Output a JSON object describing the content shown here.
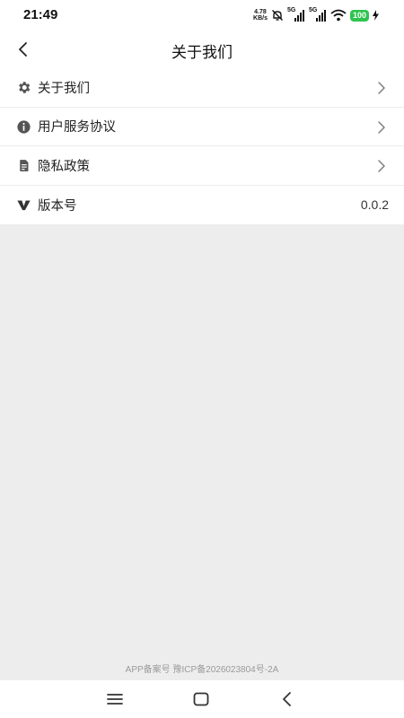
{
  "status": {
    "time": "21:49",
    "netspeed_value": "4.78",
    "netspeed_unit": "KB/s",
    "sim1": "5G",
    "sim2": "5G",
    "battery": "100"
  },
  "header": {
    "title": "关于我们",
    "back_icon": "chevron-left-icon"
  },
  "menu": {
    "items": [
      {
        "label": "关于我们",
        "icon": "gear-icon"
      },
      {
        "label": "用户服务协议",
        "icon": "info-icon"
      },
      {
        "label": "隐私政策",
        "icon": "document-icon"
      },
      {
        "label": "版本号",
        "icon": "v-icon",
        "value": "0.0.2"
      }
    ]
  },
  "footer": {
    "icp": "APP备案号 豫ICP备2026023804号-2A"
  },
  "colors": {
    "background": "#ededed",
    "battery": "#2fc34f"
  }
}
